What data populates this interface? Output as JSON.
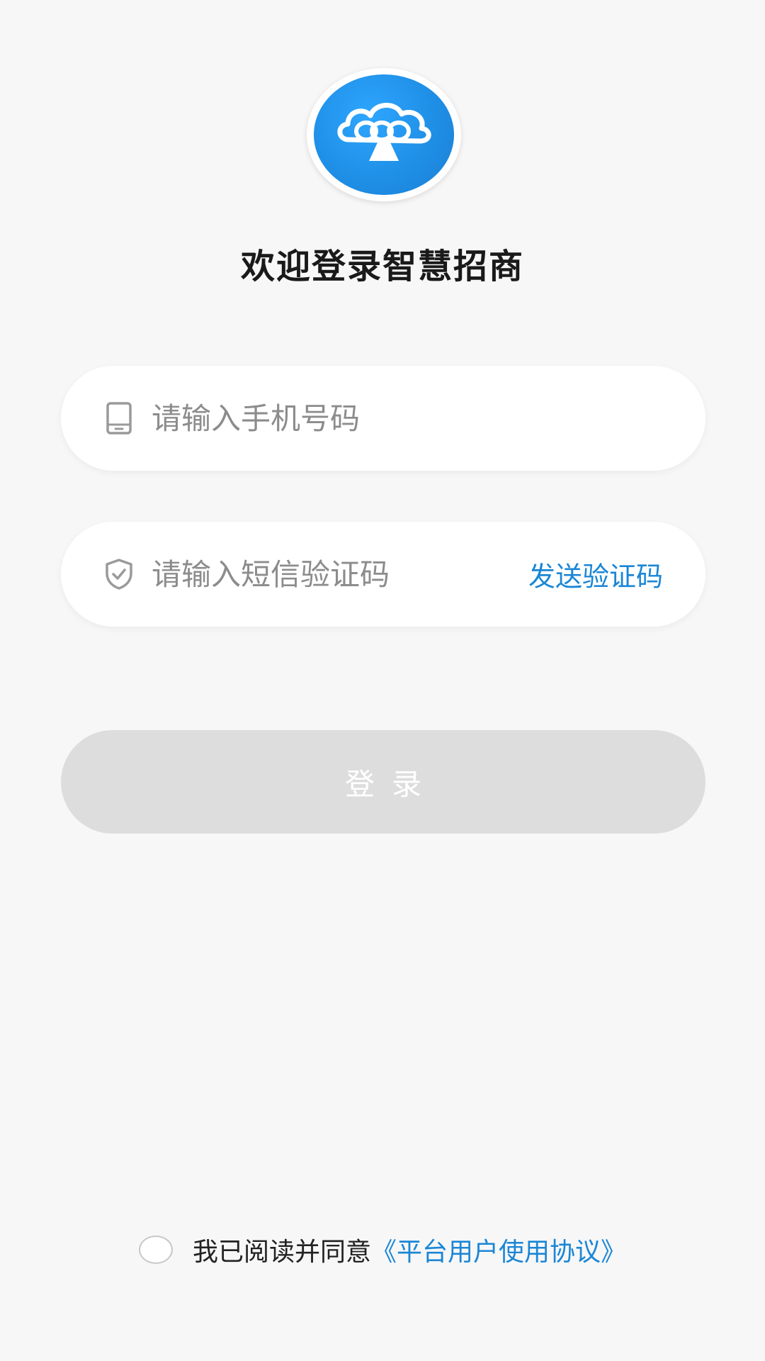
{
  "app": {
    "title": "欢迎登录智慧招商"
  },
  "colors": {
    "background": "#f7f7f7",
    "accent": "#1a86d6",
    "logo_blue": "#1f8fe6",
    "button_disabled": "#dddddd"
  },
  "icons": {
    "logo": "cloud-logo-icon",
    "phone": "phone-icon",
    "shield": "shield-check-icon"
  },
  "form": {
    "phone_placeholder": "请输入手机号码",
    "code_placeholder": "请输入短信验证码",
    "send_code_label": "发送验证码",
    "login_label": "登录"
  },
  "agreement": {
    "text": "我已阅读并同意",
    "link": "《平台用户使用协议》"
  }
}
